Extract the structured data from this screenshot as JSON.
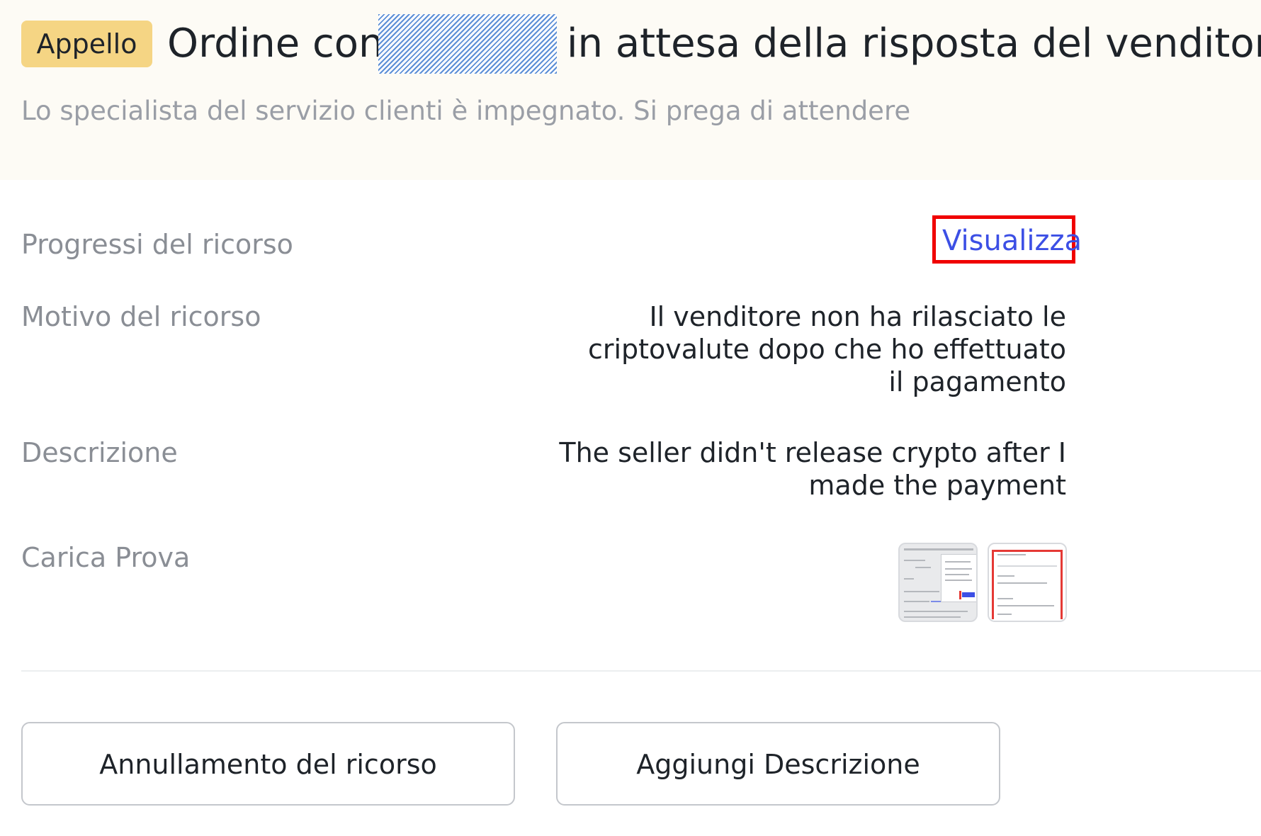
{
  "header": {
    "badge": "Appello",
    "title_prefix": "Ordine con",
    "title_suffix": "in attesa della risposta del venditore",
    "subtitle": "Lo specialista del servizio clienti è impegnato. Si prega di attendere"
  },
  "details": {
    "progress_label": "Progressi del ricorso",
    "progress_link": "Visualizza",
    "reason_label": "Motivo del ricorso",
    "reason_value": "Il venditore non ha rilasciato le criptovalute dopo che ho effettuato il pagamento",
    "description_label": "Descrizione",
    "description_value": "The seller didn't release crypto after I made the payment",
    "proof_label": "Carica Prova"
  },
  "actions": {
    "cancel_label": "Annullamento del ricorso",
    "add_description_label": "Aggiungi Descrizione"
  },
  "colors": {
    "badge_bg": "#f5d584",
    "link": "#3c4fe5",
    "highlight_border": "#f00000"
  }
}
